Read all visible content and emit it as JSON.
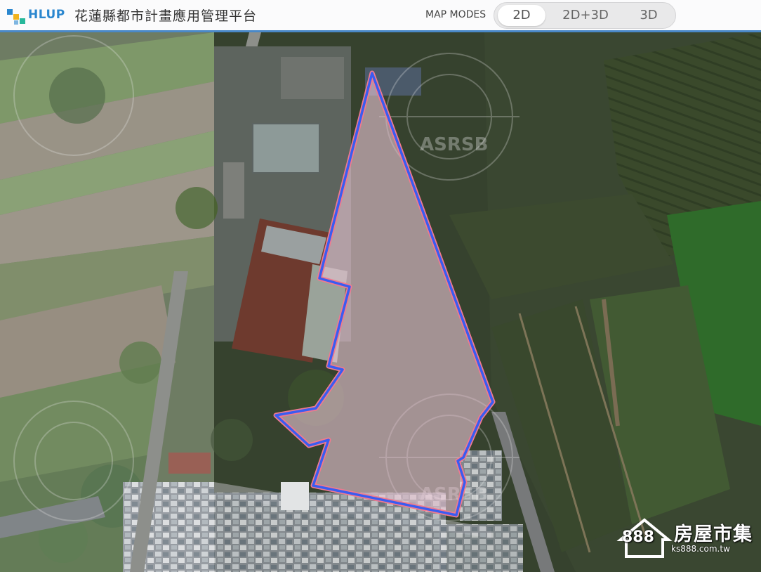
{
  "header": {
    "brand": "HLUP",
    "title": "花蓮縣都市計畫應用管理平台",
    "map_modes_label": "MAP MODES",
    "modes": [
      "2D",
      "2D+3D",
      "3D"
    ],
    "active_mode": "2D"
  },
  "map": {
    "imagery_watermark": "ASRSB",
    "parcel_fill": "#e6c4d2",
    "parcel_outline_outer": "#f07a8e",
    "parcel_outline_inner": "#3a5cf0"
  },
  "watermark": {
    "number": "888",
    "brand": "房屋市集",
    "url": "ks888.com.tw"
  }
}
